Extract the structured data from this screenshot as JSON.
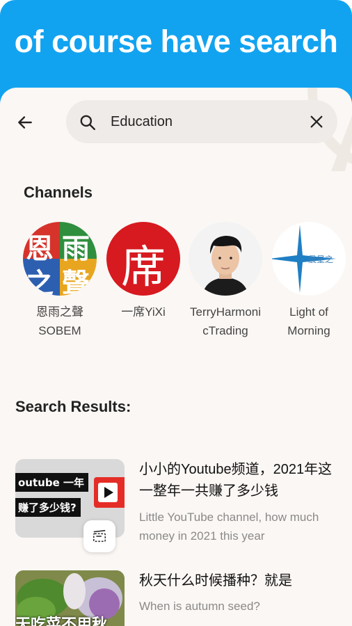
{
  "banner": {
    "title": "of course have search"
  },
  "search": {
    "value": "Education"
  },
  "channels": {
    "title": "Channels",
    "items": [
      {
        "name": "恩雨之聲 SOBEM",
        "avatar_text": [
          "恩",
          "雨",
          "之",
          "聲"
        ]
      },
      {
        "name": "一席YiXi",
        "avatar_text": "席"
      },
      {
        "name": "TerryHarmonicTrading"
      },
      {
        "name": "Light of Morning",
        "avatar_text": "晨星之"
      }
    ]
  },
  "results": {
    "title": "Search Results:",
    "items": [
      {
        "title": "小小的Youtube频道，2021年这一整年一共赚了多少钱",
        "subtitle": "Little YouTube channel, how much money in 2021 this year",
        "thumb_text_1": "outube 一年",
        "thumb_text_2": "赚了多少钱?"
      },
      {
        "title": "秋天什么时候播种？就是",
        "subtitle": "When is autumn seed?",
        "thumb_text": "天吃菜不用秋"
      }
    ]
  },
  "colors": {
    "banner": "#12a3f0",
    "sheet": "#fbf7f4",
    "search_bg": "#efebe8",
    "yixi_red": "#d71920"
  }
}
